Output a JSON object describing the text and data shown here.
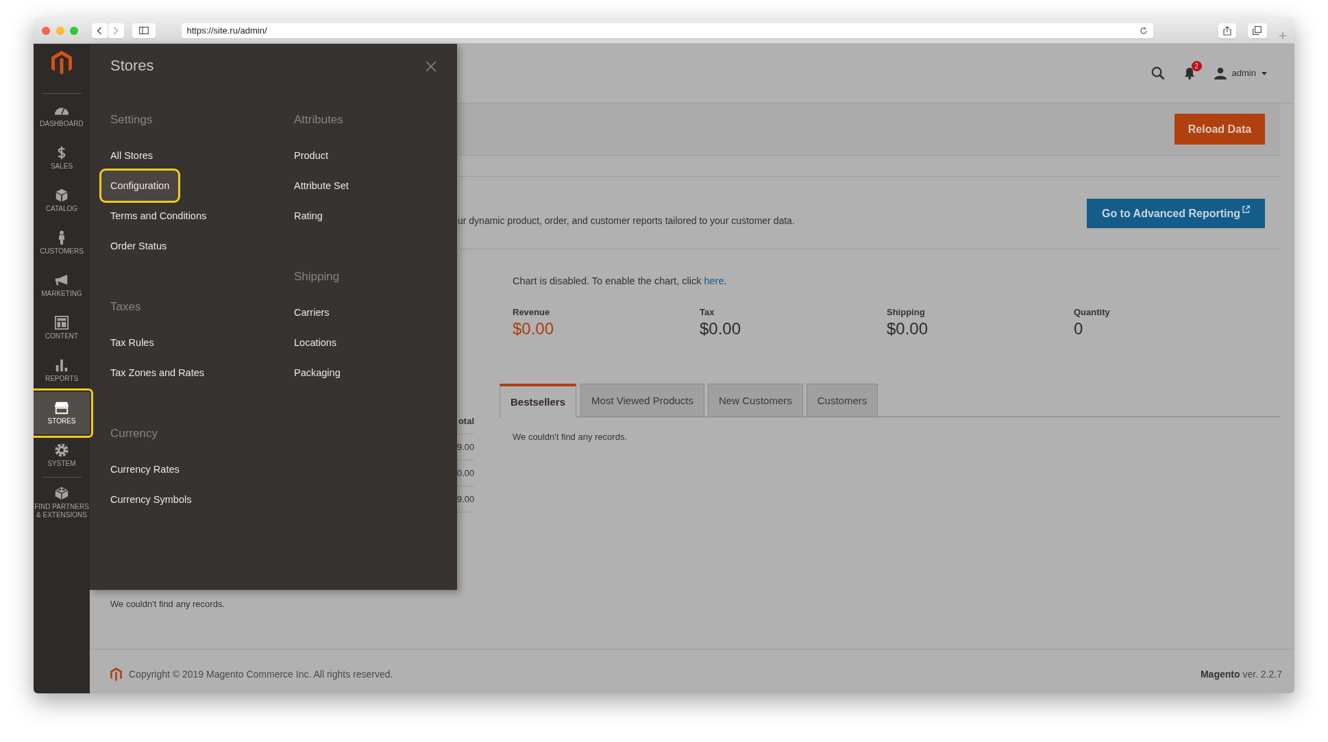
{
  "browser": {
    "url": "https://site.ru/admin/"
  },
  "sidebar": {
    "items": [
      {
        "label": "DASHBOARD",
        "kind": "dashboard",
        "selected": false,
        "highlighted": false
      },
      {
        "label": "SALES",
        "kind": "sales",
        "selected": false,
        "highlighted": false
      },
      {
        "label": "CATALOG",
        "kind": "catalog",
        "selected": false,
        "highlighted": false
      },
      {
        "label": "CUSTOMERS",
        "kind": "customers",
        "selected": false,
        "highlighted": false
      },
      {
        "label": "MARKETING",
        "kind": "marketing",
        "selected": false,
        "highlighted": false
      },
      {
        "label": "CONTENT",
        "kind": "content",
        "selected": false,
        "highlighted": false
      },
      {
        "label": "REPORTS",
        "kind": "reports",
        "selected": false,
        "highlighted": false
      },
      {
        "label": "STORES",
        "kind": "stores",
        "selected": true,
        "highlighted": true
      },
      {
        "label": "SYSTEM",
        "kind": "system",
        "selected": false,
        "highlighted": false
      }
    ],
    "extra_items": [
      {
        "label": "FIND PARTNERS & EXTENSIONS",
        "kind": "partners",
        "selected": false,
        "highlighted": false
      }
    ]
  },
  "header": {
    "notifications_count": "2",
    "user": "admin"
  },
  "page_actions": {
    "button": "Reload Data"
  },
  "advanced_reporting": {
    "text": "ur dynamic product, order, and customer reports tailored to your customer data.",
    "button": "Go to Advanced Reporting"
  },
  "chart_notice": {
    "text": "Chart is disabled. To enable the chart, click ",
    "link": "here",
    "after": "."
  },
  "totals": [
    {
      "label": "Revenue",
      "value": "$0.00",
      "accent": true
    },
    {
      "label": "Tax",
      "value": "$0.00",
      "accent": false
    },
    {
      "label": "Shipping",
      "value": "$0.00",
      "accent": false
    },
    {
      "label": "Quantity",
      "value": "0",
      "accent": false
    }
  ],
  "orders_grid": {
    "column_header": "otal",
    "cells": [
      "9.00",
      "0.00",
      "9.00"
    ]
  },
  "tabs": [
    {
      "label": "Bestsellers",
      "selected": true
    },
    {
      "label": "Most Viewed Products",
      "selected": false
    },
    {
      "label": "New Customers",
      "selected": false
    },
    {
      "label": "Customers",
      "selected": false
    }
  ],
  "tab_content": "We couldn't find any records.",
  "search_terms": {
    "empty_text": "We couldn't find any records."
  },
  "footer": {
    "copyright": "Copyright © 2019 Magento Commerce Inc. All rights reserved.",
    "product": "Magento",
    "version": "ver. 2.2.7"
  },
  "menu_panel": {
    "title": "Stores",
    "columns": [
      [
        {
          "heading": "Settings",
          "items": [
            {
              "label": "All Stores",
              "highlighted": false
            },
            {
              "label": "Configuration",
              "highlighted": true
            },
            {
              "label": "Terms and Conditions",
              "highlighted": false
            },
            {
              "label": "Order Status",
              "highlighted": false
            }
          ]
        },
        {
          "heading": "Taxes",
          "items": [
            {
              "label": "Tax Rules",
              "highlighted": false
            },
            {
              "label": "Tax Zones and Rates",
              "highlighted": false
            }
          ]
        },
        {
          "heading": "Currency",
          "items": [
            {
              "label": "Currency Rates",
              "highlighted": false
            },
            {
              "label": "Currency Symbols",
              "highlighted": false
            }
          ]
        }
      ],
      [
        {
          "heading": "Attributes",
          "items": [
            {
              "label": "Product",
              "highlighted": false
            },
            {
              "label": "Attribute Set",
              "highlighted": false
            },
            {
              "label": "Rating",
              "highlighted": false
            }
          ]
        },
        {
          "heading": "Shipping",
          "items": [
            {
              "label": "Carriers",
              "highlighted": false
            },
            {
              "label": "Locations",
              "highlighted": false
            },
            {
              "label": "Packaging",
              "highlighted": false
            }
          ]
        }
      ]
    ]
  }
}
